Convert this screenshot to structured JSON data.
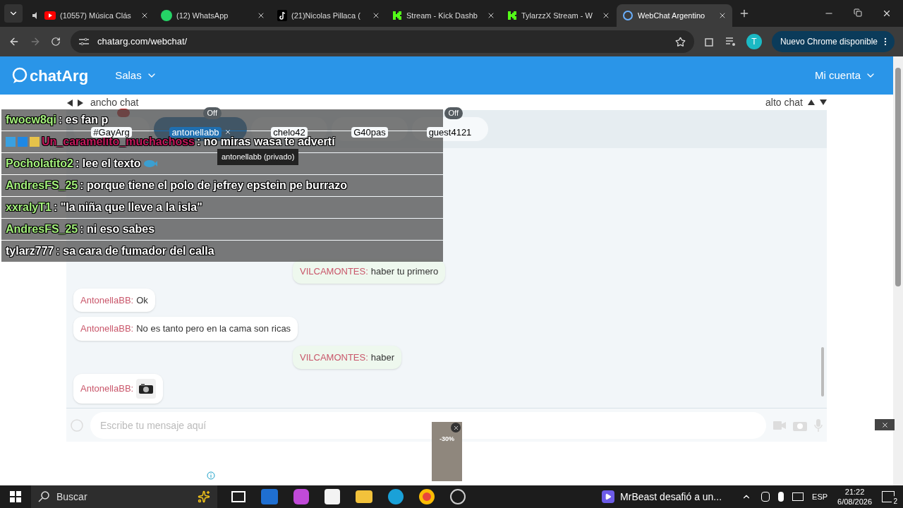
{
  "browser": {
    "tabs": [
      {
        "title": "(10557) Música Clás",
        "selected": false,
        "kind": "youtube",
        "audio": true
      },
      {
        "title": "(12) WhatsApp",
        "selected": false,
        "kind": "whatsapp",
        "audio": false
      },
      {
        "title": "(21)Nicolas Pillaca (",
        "selected": false,
        "kind": "tiktok",
        "audio": false
      },
      {
        "title": "Stream - Kick Dashb",
        "selected": false,
        "kind": "kick",
        "audio": false
      },
      {
        "title": "TylarzzX Stream - W",
        "selected": false,
        "kind": "kick",
        "audio": false
      },
      {
        "title": "WebChat Argentino",
        "selected": true,
        "kind": "chat",
        "audio": false
      }
    ],
    "url": "chatarg.com/webchat/",
    "profile_initial": "T",
    "update_button": "Nuevo Chrome disponible"
  },
  "header": {
    "logo": "chatArg",
    "rooms_menu": "Salas",
    "account_menu": "Mi cuenta"
  },
  "size_controls": {
    "width_label": "ancho chat",
    "height_label": "alto chat"
  },
  "chat_tabs": [
    {
      "label": "#GayArg",
      "selected": false,
      "alert": true,
      "closable": false
    },
    {
      "label": "antonellabb",
      "selected": true,
      "badge": "Off",
      "closable": true
    },
    {
      "label": "chelo42",
      "selected": false,
      "closable": false
    },
    {
      "label": "G40pas",
      "selected": false,
      "closable": false
    },
    {
      "label": "guest4121",
      "selected": false,
      "badge": "Off",
      "closable": false
    }
  ],
  "tooltip": "antonellabb (privado)",
  "messages": [
    {
      "author": "VILCAMONTES:",
      "text": "haber tu primero",
      "outgoing": true,
      "kind": "text"
    },
    {
      "author": "AntonellaBB:",
      "text": "Ok",
      "outgoing": false,
      "kind": "text"
    },
    {
      "author": "AntonellaBB:",
      "text": "No es tanto pero en la cama son ricas",
      "outgoing": false,
      "kind": "text"
    },
    {
      "author": "VILCAMONTES:",
      "text": "haber",
      "outgoing": true,
      "kind": "text"
    },
    {
      "author": "AntonellaBB:",
      "outgoing": false,
      "kind": "photo"
    }
  ],
  "composer": {
    "placeholder": "Escribe tu mensaje aquí"
  },
  "stream_overlay": [
    {
      "user": "fwocw8qi",
      "text": ": es fan p",
      "color": "#a4f07c",
      "badges": false,
      "emote": false
    },
    {
      "user": "Un_caramelito_muchachoss",
      "text": ": no miras wasa te advertí",
      "color": "#c2185b",
      "badges": true,
      "emote": false
    },
    {
      "user": "Pocholatito2",
      "text": ": lee el texto",
      "color": "#a4f07c",
      "badges": false,
      "emote": true
    },
    {
      "user": "AndresFS_25",
      "text": ": porque tiene el polo de jefrey epstein pe burrazo",
      "color": "#a4f07c",
      "badges": false,
      "emote": false
    },
    {
      "user": "xxralyT1",
      "text": ": \"la niña que lleve a la isla\"",
      "color": "#a4f07c",
      "badges": false,
      "emote": false
    },
    {
      "user": "AndresFS_25",
      "text": ": ni eso sabes",
      "color": "#a4f07c",
      "badges": false,
      "emote": false
    },
    {
      "user": "tylarz777",
      "text": ": sa cara de fumador del calla",
      "color": "#ffffff",
      "badges": false,
      "emote": false
    }
  ],
  "ad": {
    "discount": "-30%"
  },
  "taskbar": {
    "search": "Buscar",
    "news": "MrBeast desafió a un...",
    "language": "ESP",
    "time": "21:22",
    "date": "6/08/2026",
    "notifications": "2"
  }
}
